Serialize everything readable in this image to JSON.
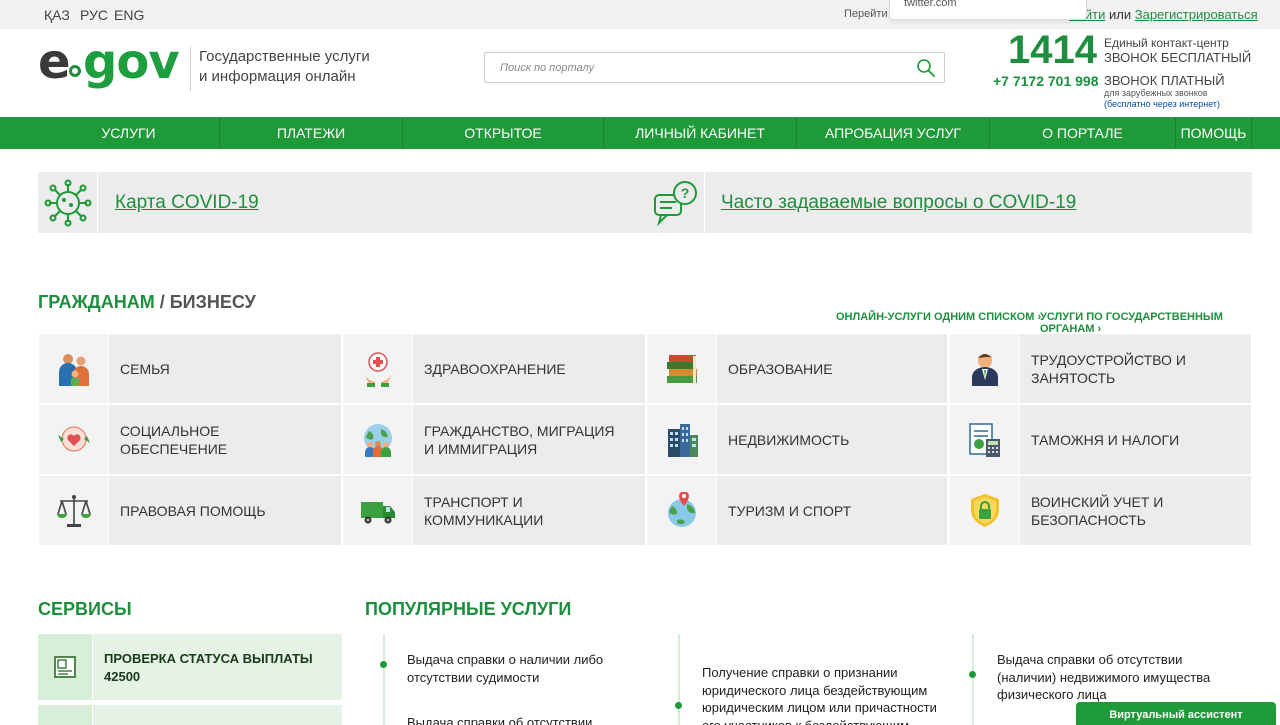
{
  "topbar": {
    "languages": [
      "ҚАЗ",
      "РУС",
      "ENG"
    ],
    "goto_text": "Перейти в р",
    "login": "Войти",
    "or": " или ",
    "register": "Зарегистрироваться",
    "popup_text": "twitter.com"
  },
  "header": {
    "logo_e": "e",
    "logo_gov": "gov",
    "tagline_line1": "Государственные услуги",
    "tagline_line2": "и информация онлайн",
    "search_placeholder": "Поиск по порталу",
    "contact_number": "1414",
    "contact_line1": "Единый контакт-центр",
    "contact_line2": "ЗВОНОК БЕСПЛАТНЫЙ",
    "phone": "+7 7172 701 998",
    "paid": "ЗВОНОК ПЛАТНЫЙ",
    "foreign": "для зарубежных звонков",
    "free_net": "(бесплатно через интернет)"
  },
  "nav": [
    "УСЛУГИ",
    "ПЛАТЕЖИ",
    "ОТКРЫТОЕ ПРАВИТЕЛЬСТВО",
    "ЛИЧНЫЙ КАБИНЕТ",
    "АПРОБАЦИЯ УСЛУГ",
    "О ПОРТАЛЕ",
    "ПОМОЩЬ"
  ],
  "covid": {
    "map": "Карта COVID-19",
    "faq": "Часто задаваемые вопросы о COVID-19"
  },
  "categories": {
    "title_citizens": "ГРАЖДАНАМ",
    "slash": " / ",
    "title_business": "БИЗНЕСУ",
    "link_online": "ОНЛАЙН-УСЛУГИ ОДНИМ СПИСКОМ ›",
    "link_bodies": "УСЛУГИ ПО ГОСУДАРСТВЕННЫМ ОРГАНАМ ›",
    "items": [
      "СЕМЬЯ",
      "ЗДРАВООХРАНЕНИЕ",
      "ОБРАЗОВАНИЕ",
      "ТРУДОУСТРОЙСТВО И ЗАНЯТОСТЬ",
      "СОЦИАЛЬНОЕ ОБЕСПЕЧЕНИЕ",
      "ГРАЖДАНСТВО, МИГРАЦИЯ И ИММИГРАЦИЯ",
      "НЕДВИЖИМОСТЬ",
      "ТАМОЖНЯ И НАЛОГИ",
      "ПРАВОВАЯ ПОМОЩЬ",
      "ТРАНСПОРТ И КОММУНИКАЦИИ",
      "ТУРИЗМ И СПОРТ",
      "ВОИНСКИЙ УЧЕТ И БЕЗОПАСНОСТЬ"
    ]
  },
  "services": {
    "title": "СЕРВИСЫ",
    "items": [
      "ПРОВЕРКА СТАТУСА ВЫПЛАТЫ 42500"
    ]
  },
  "popular": {
    "title": "ПОПУЛЯРНЫЕ УСЛУГИ",
    "items": [
      "Выдача справки о наличии либо отсутствии судимости",
      "Получение справки о признании юридического лица бездействующим юридическим лицом или причастности его участников к бездействующим",
      "Выдача справки об отсутствии (наличии) недвижимого имущества физического лица",
      "Выдача справки об отсутствии"
    ]
  },
  "assistant": "Виртуальный ассистент"
}
